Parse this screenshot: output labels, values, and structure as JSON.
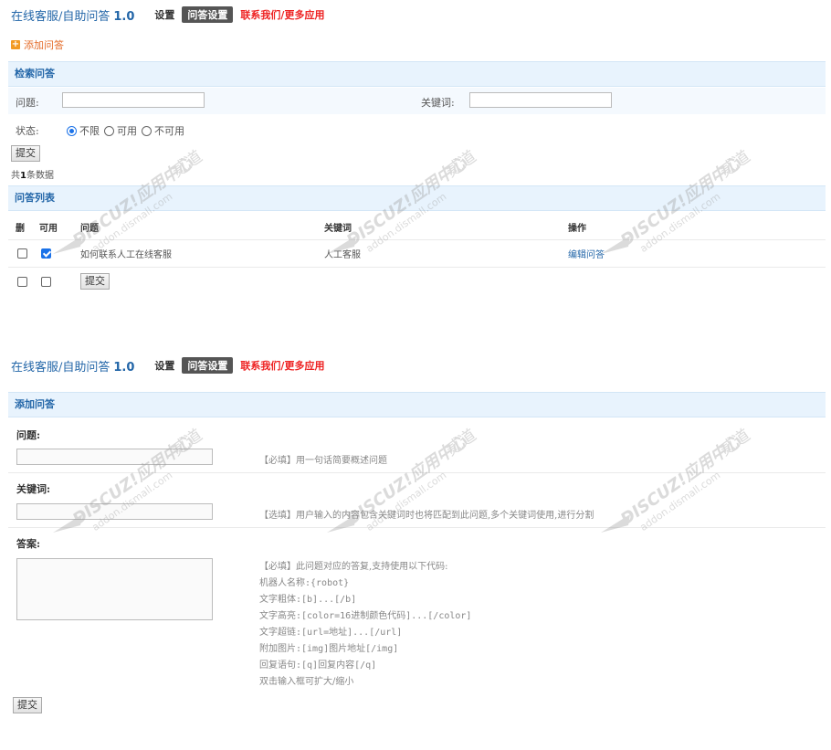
{
  "header": {
    "title": "在线客服/自助问答",
    "version": "1.0",
    "nav": {
      "settings": "设置",
      "qa_settings": "问答设置",
      "contact": "联系我们/更多应用"
    }
  },
  "search_view": {
    "add_link": "添加问答",
    "search_section": "检索问答",
    "question_label": "问题:",
    "keyword_label": "关键词:",
    "status_label": "状态:",
    "status_options": [
      "不限",
      "可用",
      "不可用"
    ],
    "status_selected": "不限",
    "submit": "提交",
    "count_prefix": "共",
    "count_value": "1",
    "count_suffix": "条数据",
    "list_section": "问答列表",
    "columns": [
      "删",
      "可用",
      "问题",
      "关键词",
      "操作"
    ],
    "rows": [
      {
        "delete": false,
        "enabled": true,
        "question": "如何联系人工在线客服",
        "keyword": "人工客服",
        "action": "编辑问答"
      }
    ],
    "footer_submit": "提交"
  },
  "add_view": {
    "section": "添加问答",
    "question_label": "问题:",
    "question_hint": "【必填】用一句话简要概述问题",
    "keyword_label": "关键词:",
    "keyword_hint": "【选填】用户输入的内容包含关键词时也将匹配到此问题,多个关键词使用,进行分割",
    "answer_label": "答案:",
    "answer_hints": [
      "【必填】此问题对应的答复,支持使用以下代码:",
      "机器人名称:{robot}",
      "文字粗体:[b]...[/b]",
      "文字高亮:[color=16进制颜色代码]...[/color]",
      "文字超链:[url=地址]...[/url]",
      "附加图片:[img]图片地址[/img]",
      "回复语句:[q]回复内容[/q]",
      "双击输入框可扩大/缩小"
    ],
    "submit": "提交"
  },
  "colors": {
    "accent": "#2366a8",
    "section_bg": "#e8f3fd",
    "red_link": "#ee2222",
    "add_orange": "#e46c29",
    "check_blue": "#1b72e8"
  },
  "watermark": {
    "brand": "DISCUZ!应用中心",
    "domain": "addon.dismall.com",
    "mark": "贰道"
  }
}
